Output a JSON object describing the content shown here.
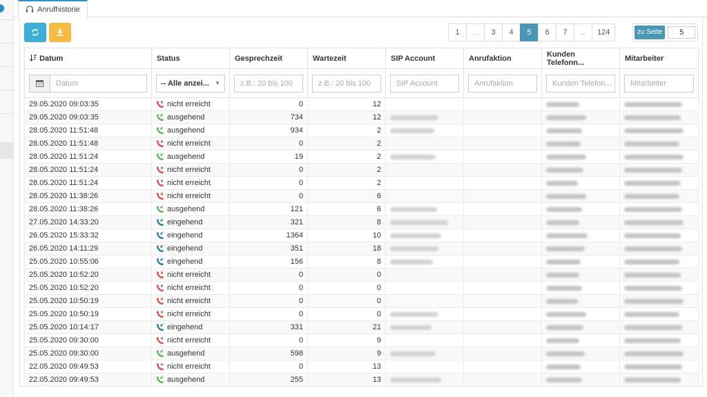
{
  "tab": {
    "label": "Anrufhistorie"
  },
  "pagination": {
    "pages": [
      "1",
      "...",
      "3",
      "4",
      "5",
      "6",
      "7",
      "...",
      "124"
    ],
    "active": "5",
    "goto_label": "zu Seite",
    "goto_value": "5"
  },
  "columns": [
    "Datum",
    "Status",
    "Gesprechzeit",
    "Wartezeit",
    "SIP Account",
    "Anrufaktion",
    "Kunden Telefonn...",
    "Mitarbeiter"
  ],
  "filters": {
    "date_placeholder": "Datum",
    "status_selected": "-- Alle anzei...",
    "talk_placeholder": "z.B.: 20 bis 100",
    "wait_placeholder": "z.B.: 20 bis 100",
    "sip_placeholder": "SIP Account",
    "action_placeholder": "Anrufaktion",
    "phone_placeholder": "Kunden Telefon...",
    "employee_placeholder": "Mitarbeiter"
  },
  "status_colors": {
    "nicht erreicht": "#d9534f",
    "ausgehend": "#5cb85c",
    "eingehend": "#2e7fb0"
  },
  "rows": [
    {
      "date": "29.05.2020 09:03:35",
      "status": "nicht erreicht",
      "talk": "0",
      "wait": "12",
      "sip": false
    },
    {
      "date": "29.05.2020 09:03:35",
      "status": "ausgehend",
      "talk": "734",
      "wait": "12",
      "sip": true
    },
    {
      "date": "28.05.2020 11:51:48",
      "status": "ausgehend",
      "talk": "934",
      "wait": "2",
      "sip": true
    },
    {
      "date": "28.05.2020 11:51:48",
      "status": "nicht erreicht",
      "talk": "0",
      "wait": "2",
      "sip": false
    },
    {
      "date": "28.05.2020 11:51:24",
      "status": "ausgehend",
      "talk": "19",
      "wait": "2",
      "sip": true
    },
    {
      "date": "28.05.2020 11:51:24",
      "status": "nicht erreicht",
      "talk": "0",
      "wait": "2",
      "sip": false
    },
    {
      "date": "28.05.2020 11:51:24",
      "status": "nicht erreicht",
      "talk": "0",
      "wait": "2",
      "sip": false
    },
    {
      "date": "28.05.2020 11:38:26",
      "status": "nicht erreicht",
      "talk": "0",
      "wait": "6",
      "sip": false
    },
    {
      "date": "28.05.2020 11:38:26",
      "status": "ausgehend",
      "talk": "121",
      "wait": "6",
      "sip": true
    },
    {
      "date": "27.05.2020 14:33:20",
      "status": "eingehend",
      "talk": "321",
      "wait": "8",
      "sip": true
    },
    {
      "date": "26.05.2020 15:33:32",
      "status": "eingehend",
      "talk": "1364",
      "wait": "10",
      "sip": true
    },
    {
      "date": "26.05.2020 14:11:29",
      "status": "eingehend",
      "talk": "351",
      "wait": "18",
      "sip": true
    },
    {
      "date": "25.05.2020 10:55:06",
      "status": "eingehend",
      "talk": "156",
      "wait": "8",
      "sip": true
    },
    {
      "date": "25.05.2020 10:52:20",
      "status": "nicht erreicht",
      "talk": "0",
      "wait": "0",
      "sip": false
    },
    {
      "date": "25.05.2020 10:52:20",
      "status": "nicht erreicht",
      "talk": "0",
      "wait": "0",
      "sip": false
    },
    {
      "date": "25.05.2020 10:50:19",
      "status": "nicht erreicht",
      "talk": "0",
      "wait": "0",
      "sip": false
    },
    {
      "date": "25.05.2020 10:50:19",
      "status": "nicht erreicht",
      "talk": "0",
      "wait": "0",
      "sip": true
    },
    {
      "date": "25.05.2020 10:14:17",
      "status": "eingehend",
      "talk": "331",
      "wait": "21",
      "sip": true
    },
    {
      "date": "25.05.2020 09:30:00",
      "status": "nicht erreicht",
      "talk": "0",
      "wait": "9",
      "sip": false
    },
    {
      "date": "25.05.2020 09:30:00",
      "status": "ausgehend",
      "talk": "598",
      "wait": "9",
      "sip": true
    },
    {
      "date": "22.05.2020 09:49:53",
      "status": "nicht erreicht",
      "talk": "0",
      "wait": "13",
      "sip": false
    },
    {
      "date": "22.05.2020 09:49:53",
      "status": "ausgehend",
      "talk": "255",
      "wait": "13",
      "sip": true
    }
  ]
}
